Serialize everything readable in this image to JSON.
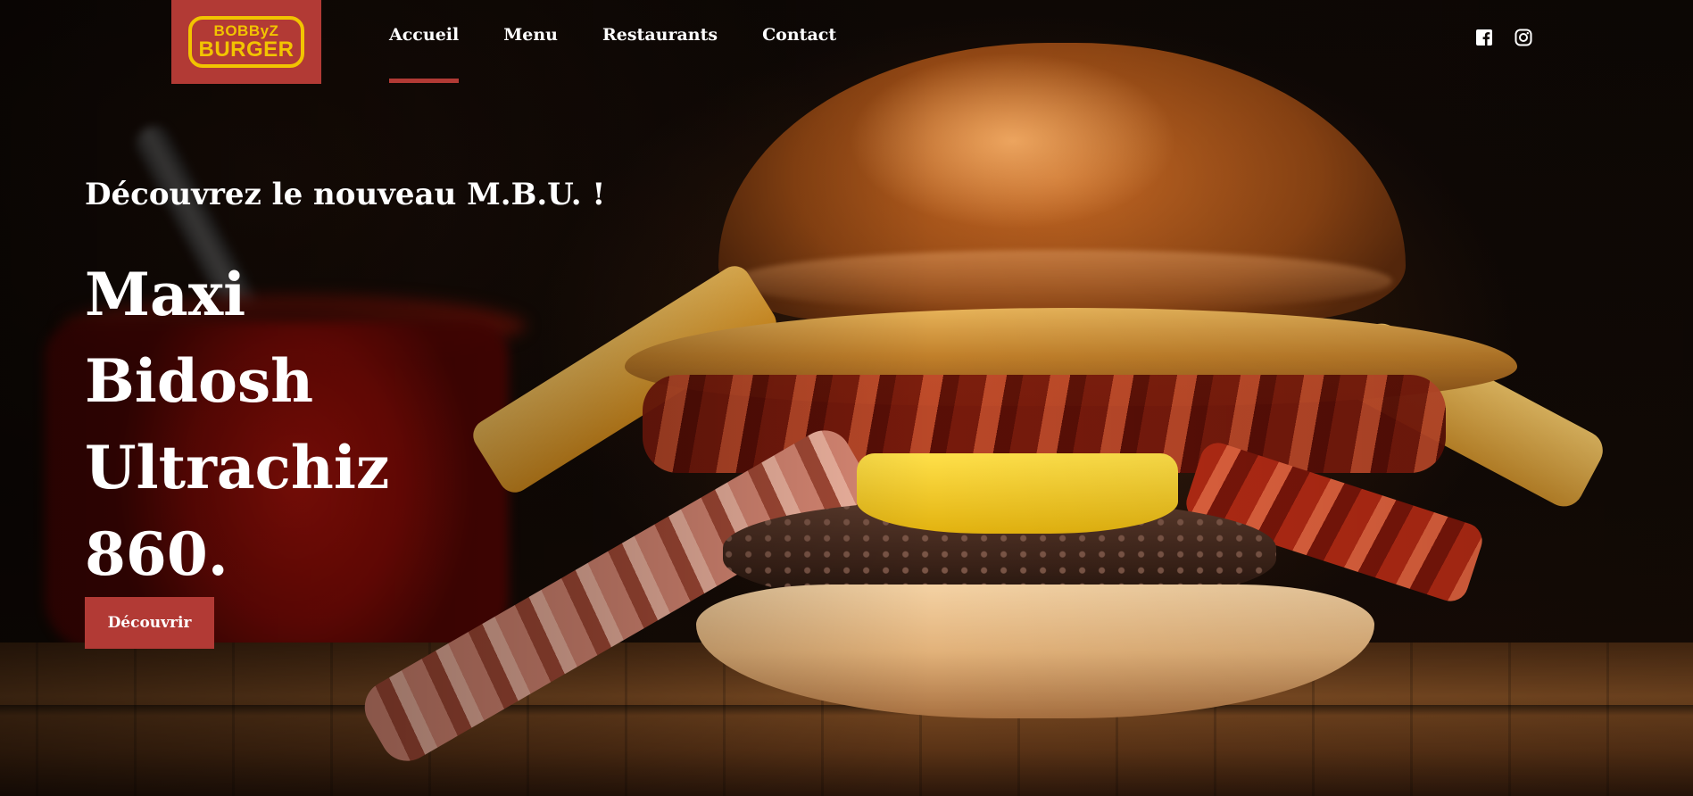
{
  "brand": {
    "logo_line1": "BOBByZ",
    "logo_line2": "BURGER",
    "logo_bg": "#b23a35",
    "logo_fg": "#f2c400"
  },
  "nav": {
    "items": [
      {
        "label": "Accueil",
        "active": true
      },
      {
        "label": "Menu",
        "active": false
      },
      {
        "label": "Restaurants",
        "active": false
      },
      {
        "label": "Contact",
        "active": false
      }
    ],
    "accent": "#b23a35"
  },
  "social": {
    "icons": [
      "facebook-icon",
      "instagram-icon"
    ]
  },
  "hero": {
    "eyebrow": "Découvrez le nouveau M.B.U. !",
    "title_lines": [
      "Maxi",
      "Bidosh",
      "Ultrachiz",
      "860."
    ],
    "cta_label": "Découvrir"
  }
}
